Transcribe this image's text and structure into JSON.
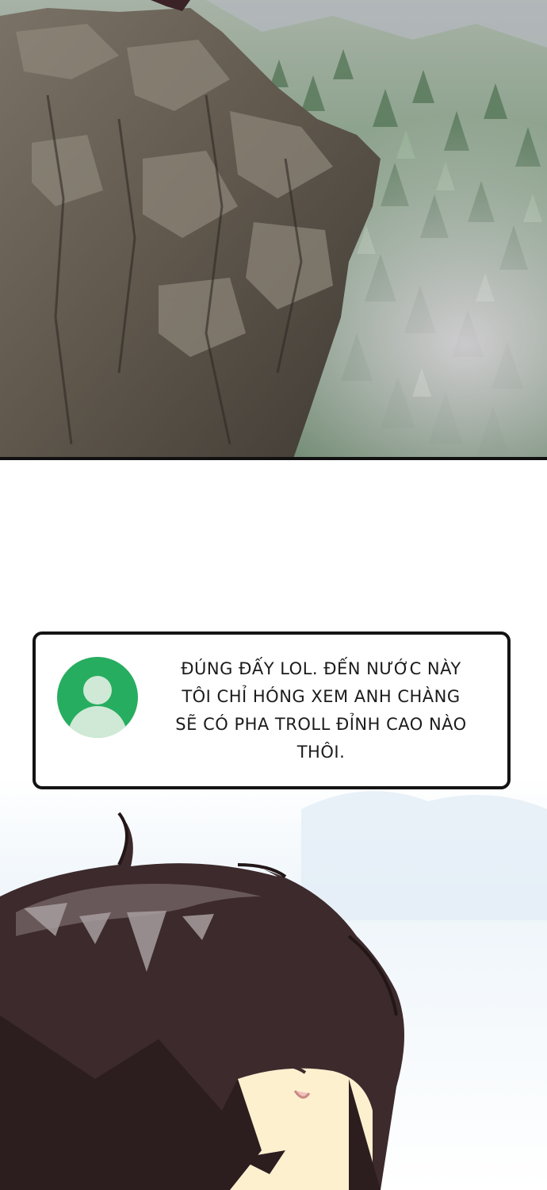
{
  "chat": {
    "lines": [
      "ĐÚNG ĐẤY LOL. ĐẾN NƯỚC NÀY",
      "TÔI CHỈ HÓNG XEM ANH CHÀNG",
      "SẼ CÓ PHA TROLL ĐỈNH CAO NÀO",
      "THÔI."
    ],
    "avatar_icon": "user-avatar-icon",
    "avatar_color": "#27ad5f"
  },
  "scene": {
    "top_panel": "cliff-and-forest-illustration",
    "bottom_panel": "character-hair-illustration"
  }
}
